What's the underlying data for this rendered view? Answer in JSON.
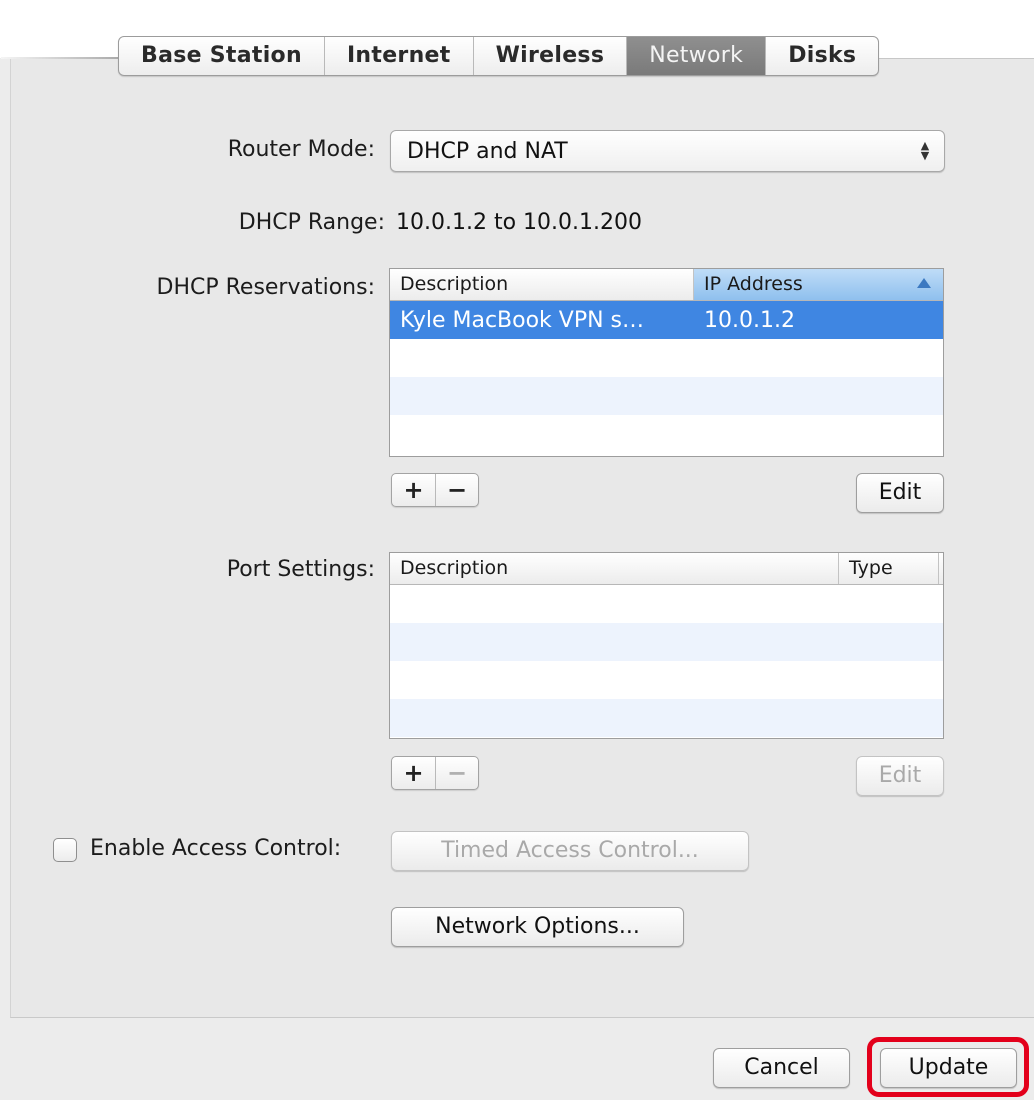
{
  "tabs": [
    {
      "label": "Base Station"
    },
    {
      "label": "Internet"
    },
    {
      "label": "Wireless"
    },
    {
      "label": "Network",
      "selected": true
    },
    {
      "label": "Disks"
    }
  ],
  "router_mode": {
    "label": "Router Mode:",
    "value": "DHCP and NAT"
  },
  "dhcp_range": {
    "label": "DHCP Range:",
    "value": "10.0.1.2 to 10.0.1.200"
  },
  "dhcp_reservations": {
    "label": "DHCP Reservations:",
    "columns": {
      "description": "Description",
      "ip": "IP Address"
    },
    "sort_column": "IP Address",
    "rows": [
      {
        "description": "Kyle MacBook VPN s…",
        "ip": "10.0.1.2"
      }
    ],
    "add_label": "+",
    "remove_label": "−",
    "edit_label": "Edit"
  },
  "port_settings": {
    "label": "Port Settings:",
    "columns": {
      "description": "Description",
      "type": "Type"
    },
    "rows": [],
    "add_label": "+",
    "remove_label": "−",
    "edit_label": "Edit"
  },
  "access_control": {
    "label": "Enable Access Control:",
    "checked": false,
    "timed_button": "Timed Access Control..."
  },
  "network_options_button": "Network Options...",
  "footer": {
    "cancel": "Cancel",
    "update": "Update"
  },
  "colors": {
    "selection": "#3f86e2",
    "highlight": "#e3001b",
    "selected_tab": "#858585"
  }
}
